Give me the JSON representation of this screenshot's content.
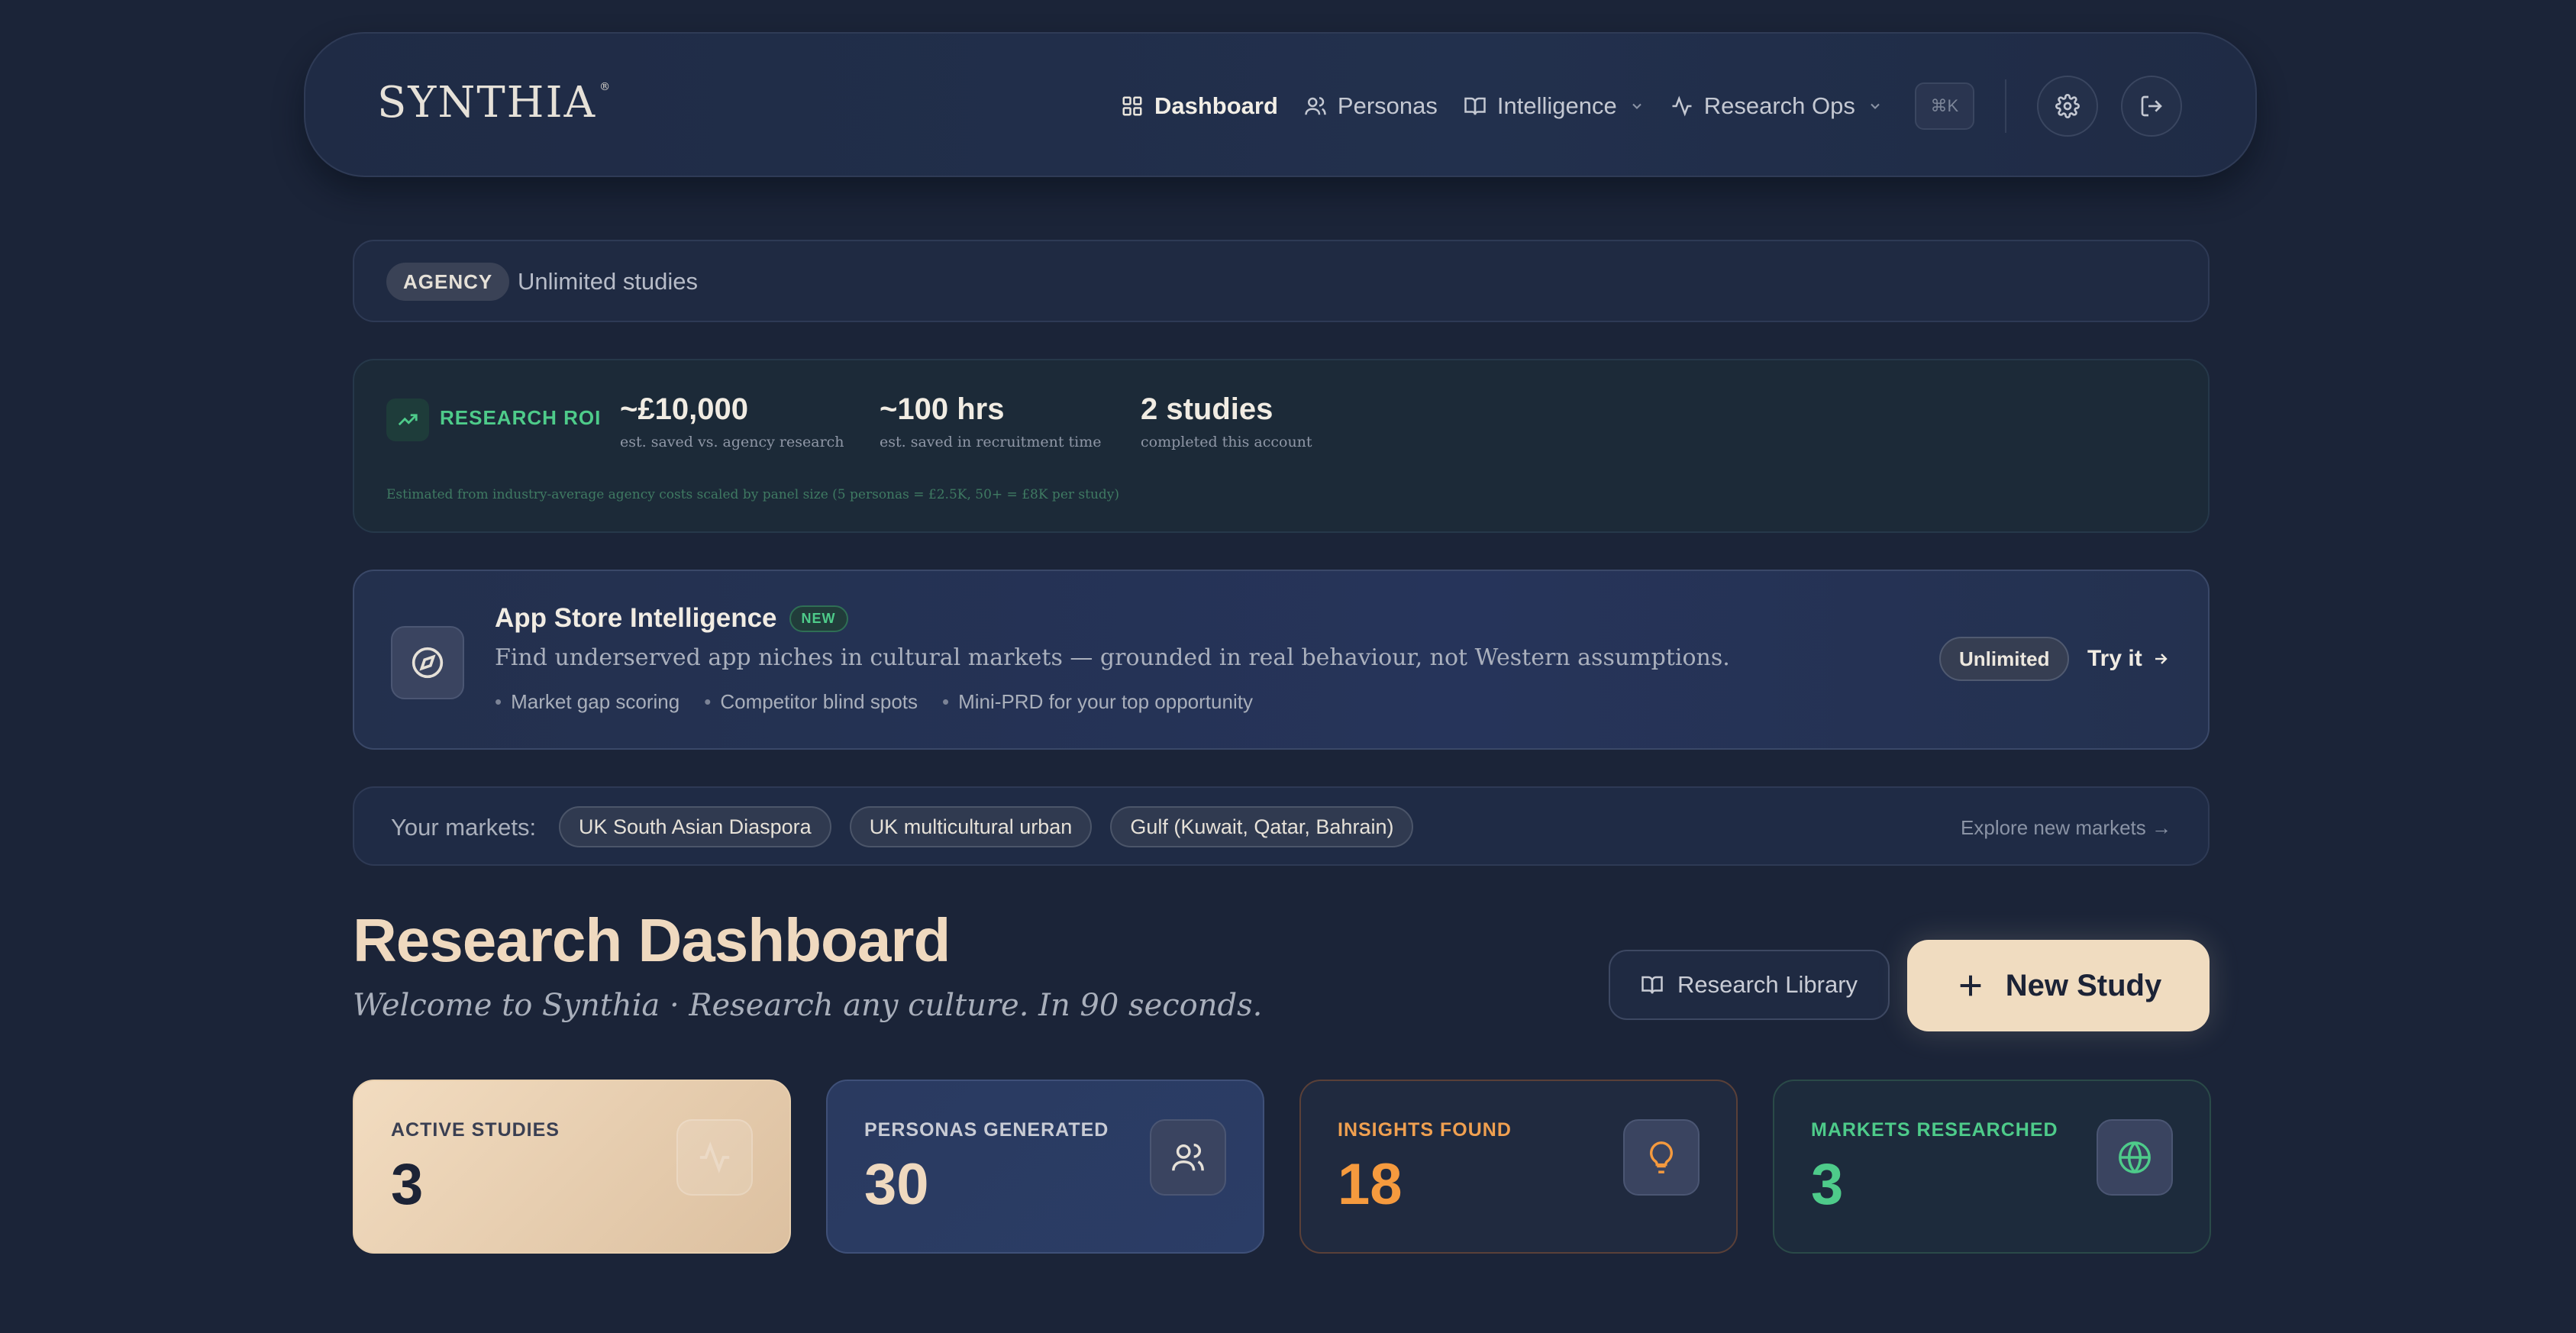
{
  "nav": {
    "logo": "SYNTHIA",
    "logo_mark": "®",
    "items": [
      {
        "label": "Dashboard"
      },
      {
        "label": "Personas"
      },
      {
        "label": "Intelligence"
      },
      {
        "label": "Research Ops"
      }
    ],
    "shortcut": "⌘K"
  },
  "plan": {
    "badge": "AGENCY",
    "text": "Unlimited studies"
  },
  "roi": {
    "label": "RESEARCH ROI",
    "stats": [
      {
        "value": "~£10,000",
        "sub": "est. saved vs. agency research"
      },
      {
        "value": "~100 hrs",
        "sub": "est. saved in recruitment time"
      },
      {
        "value": "2 studies",
        "sub": "completed this account"
      }
    ],
    "footnote": "Estimated from industry-average agency costs scaled by panel size (5 personas = £2.5K, 50+ = £8K per study)"
  },
  "app_store": {
    "title": "App Store Intelligence",
    "badge": "NEW",
    "description": "Find underserved app niches in cultural markets — grounded in real behaviour, not Western assumptions.",
    "bullets": [
      "Market gap scoring",
      "Competitor blind spots",
      "Mini-PRD for your top opportunity"
    ],
    "plan_badge": "Unlimited",
    "cta": "Try it"
  },
  "markets": {
    "label": "Your markets:",
    "chips": [
      "UK South Asian Diaspora",
      "UK multicultural urban",
      "Gulf (Kuwait, Qatar, Bahrain)"
    ],
    "explore": "Explore new markets →"
  },
  "header": {
    "title": "Research Dashboard",
    "subtitle": "Welcome to Synthia · Research any culture. In 90 seconds.",
    "library_button": "Research Library",
    "new_study_button": "New Study"
  },
  "stats": [
    {
      "label": "ACTIVE STUDIES",
      "value": "3",
      "icon": "activity-icon"
    },
    {
      "label": "PERSONAS GENERATED",
      "value": "30",
      "icon": "users-icon"
    },
    {
      "label": "INSIGHTS FOUND",
      "value": "18",
      "icon": "lightbulb-icon"
    },
    {
      "label": "MARKETS RESEARCHED",
      "value": "3",
      "icon": "globe-icon"
    }
  ],
  "colors": {
    "background": "#1b2438",
    "accent_cream": "#f0dcc0",
    "accent_green": "#4ecb8a",
    "accent_orange": "#f59a3e"
  }
}
